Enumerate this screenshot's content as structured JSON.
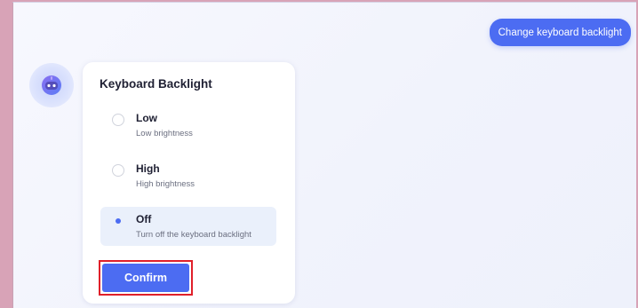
{
  "chat": {
    "user_message": "Change keyboard backlight"
  },
  "assistant": {
    "avatar_icon": "robot-icon"
  },
  "card": {
    "title": "Keyboard Backlight",
    "options": [
      {
        "label": "Low",
        "description": "Low brightness",
        "selected": false
      },
      {
        "label": "High",
        "description": "High brightness",
        "selected": false
      },
      {
        "label": "Off",
        "description": "Turn off the keyboard backlight",
        "selected": true
      }
    ],
    "confirm_label": "Confirm"
  },
  "colors": {
    "accent": "#4c6cf2",
    "selected_bg": "#eaf0fb",
    "highlight_border": "#e0202a",
    "page_bg": "#d8a3b7"
  }
}
